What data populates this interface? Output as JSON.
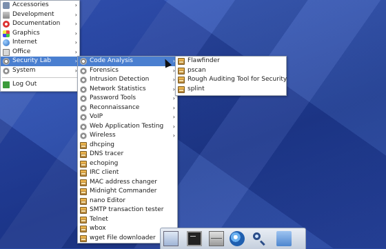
{
  "main_menu": {
    "items": [
      {
        "label": "Accessories",
        "icon": "accessories-icon",
        "submenu": true
      },
      {
        "label": "Development",
        "icon": "development-icon",
        "submenu": true
      },
      {
        "label": "Documentation",
        "icon": "documentation-icon",
        "submenu": true
      },
      {
        "label": "Graphics",
        "icon": "graphics-icon",
        "submenu": true
      },
      {
        "label": "Internet",
        "icon": "internet-icon",
        "submenu": true
      },
      {
        "label": "Office",
        "icon": "office-icon",
        "submenu": true
      },
      {
        "label": "Security Lab",
        "icon": "security-lab-icon",
        "submenu": true,
        "highlighted": true
      },
      {
        "label": "System",
        "icon": "system-icon",
        "submenu": true
      },
      {
        "label": "Log Out",
        "icon": "logout-icon",
        "submenu": false
      }
    ]
  },
  "security_menu": {
    "items": [
      {
        "label": "Code Analysis",
        "submenu": true,
        "highlighted": true
      },
      {
        "label": "Forensics",
        "submenu": true
      },
      {
        "label": "Intrusion Detection",
        "submenu": true
      },
      {
        "label": "Network Statistics",
        "submenu": true
      },
      {
        "label": "Password Tools",
        "submenu": true
      },
      {
        "label": "Reconnaissance",
        "submenu": true
      },
      {
        "label": "VoIP",
        "submenu": true
      },
      {
        "label": "Web Application Testing",
        "submenu": true
      },
      {
        "label": "Wireless",
        "submenu": true
      },
      {
        "label": "dhcping"
      },
      {
        "label": "DNS tracer"
      },
      {
        "label": "echoping"
      },
      {
        "label": "IRC client"
      },
      {
        "label": "MAC address changer"
      },
      {
        "label": "Midnight Commander"
      },
      {
        "label": "nano Editor"
      },
      {
        "label": "SMTP transaction tester"
      },
      {
        "label": "Telnet"
      },
      {
        "label": "wbox"
      },
      {
        "label": "wget File downloader"
      }
    ]
  },
  "code_analysis_menu": {
    "items": [
      {
        "label": "Flawfinder"
      },
      {
        "label": "pscan"
      },
      {
        "label": "Rough Auditing Tool for Security"
      },
      {
        "label": "splint"
      }
    ]
  },
  "arrow_glyph": "›",
  "colors": {
    "highlight": "#4a7fd0",
    "desktop": "#2a4aa3"
  }
}
